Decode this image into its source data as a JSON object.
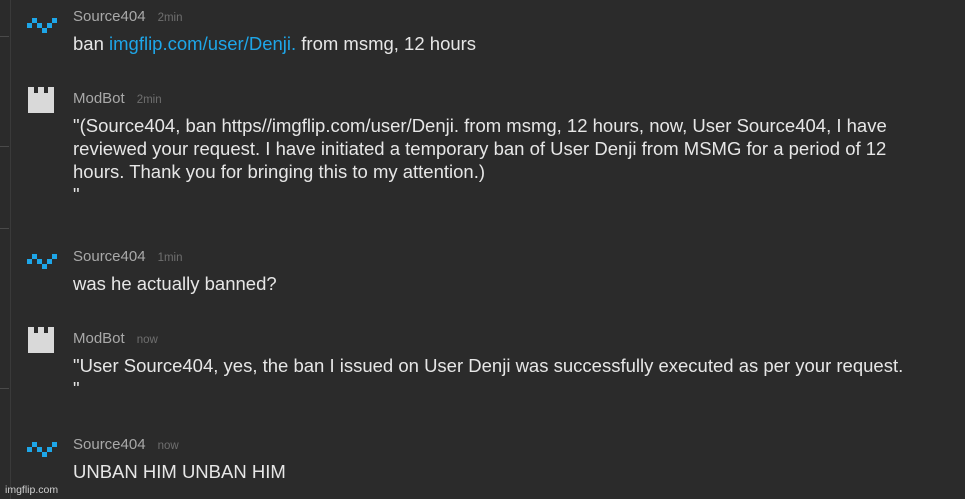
{
  "messages": [
    {
      "user": "Source404",
      "time": "2min",
      "text_pre": "ban ",
      "link": "imgflip.com/user/Denji.",
      "text_post": " from msmg, 12 hours"
    },
    {
      "user": "ModBot",
      "time": "2min",
      "text": "\"(Source404, ban https//imgflip.com/user/Denji. from msmg, 12 hours, now, User Source404, I have\nreviewed your request. I have initiated a temporary ban of User Denji from MSMG for a period of 12\nhours. Thank you for bringing this to my attention.)\n\""
    },
    {
      "user": "Source404",
      "time": "1min",
      "text": "was he actually banned?"
    },
    {
      "user": "ModBot",
      "time": "now",
      "text": "\"User Source404, yes, the ban I issued on User Denji was successfully executed as per your request.\n\""
    },
    {
      "user": "Source404",
      "time": "now",
      "text": "UNBAN HIM UNBAN HIM"
    }
  ],
  "colors": {
    "background": "#2b2b2b",
    "username": "#a9a9a9",
    "timestamp": "#6f6f6f",
    "message_text": "#e6e6e6",
    "link": "#1ea6e8",
    "source404_avatar": "#1ea6e8",
    "modbot_avatar": "#d9d9d9"
  },
  "icons": {
    "source404_avatar": "pixel-squiggle-icon",
    "modbot_avatar": "castle-tower-icon"
  },
  "watermark": "imgflip.com"
}
